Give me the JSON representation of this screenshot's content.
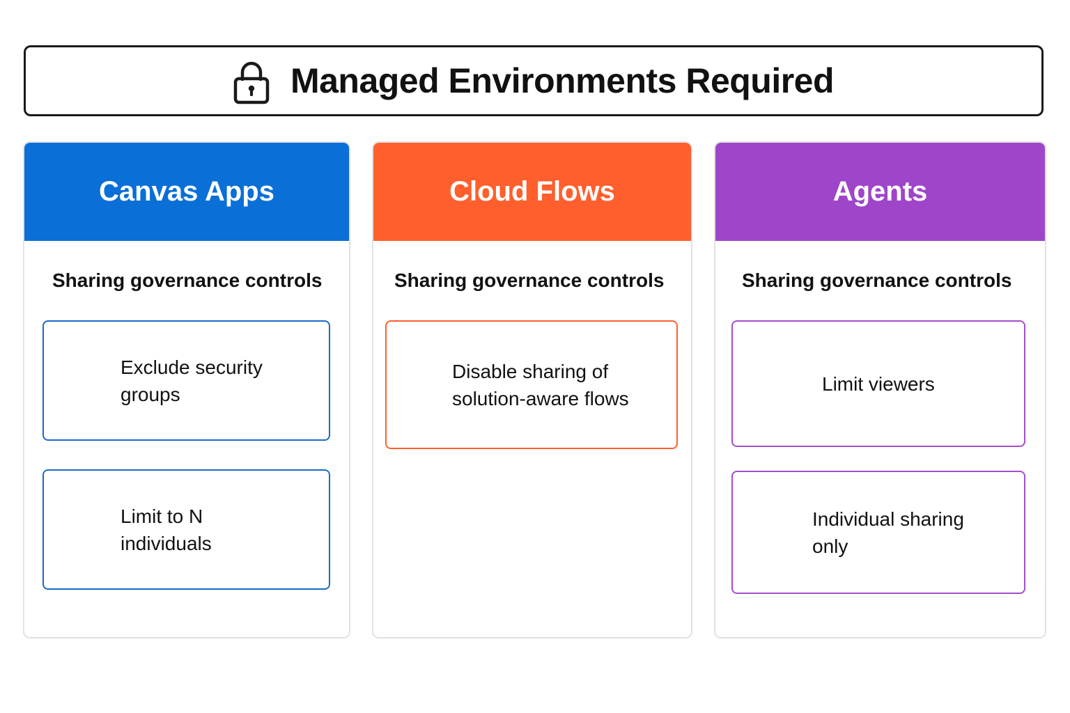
{
  "header": {
    "title": "Managed Environments Required",
    "icon": "lock-icon"
  },
  "columns": [
    {
      "title": "Canvas Apps",
      "color": "#0a6fd6",
      "section_label": "Sharing governance controls",
      "controls": [
        "Exclude security groups",
        "Limit to N individuals"
      ]
    },
    {
      "title": "Cloud Flows",
      "color": "#ff5f2c",
      "section_label": "Sharing governance controls",
      "controls": [
        "Disable sharing of solution-aware flows"
      ]
    },
    {
      "title": "Agents",
      "color": "#9f45c9",
      "section_label": "Sharing governance controls",
      "controls": [
        "Limit viewers",
        "Individual sharing only"
      ]
    }
  ]
}
